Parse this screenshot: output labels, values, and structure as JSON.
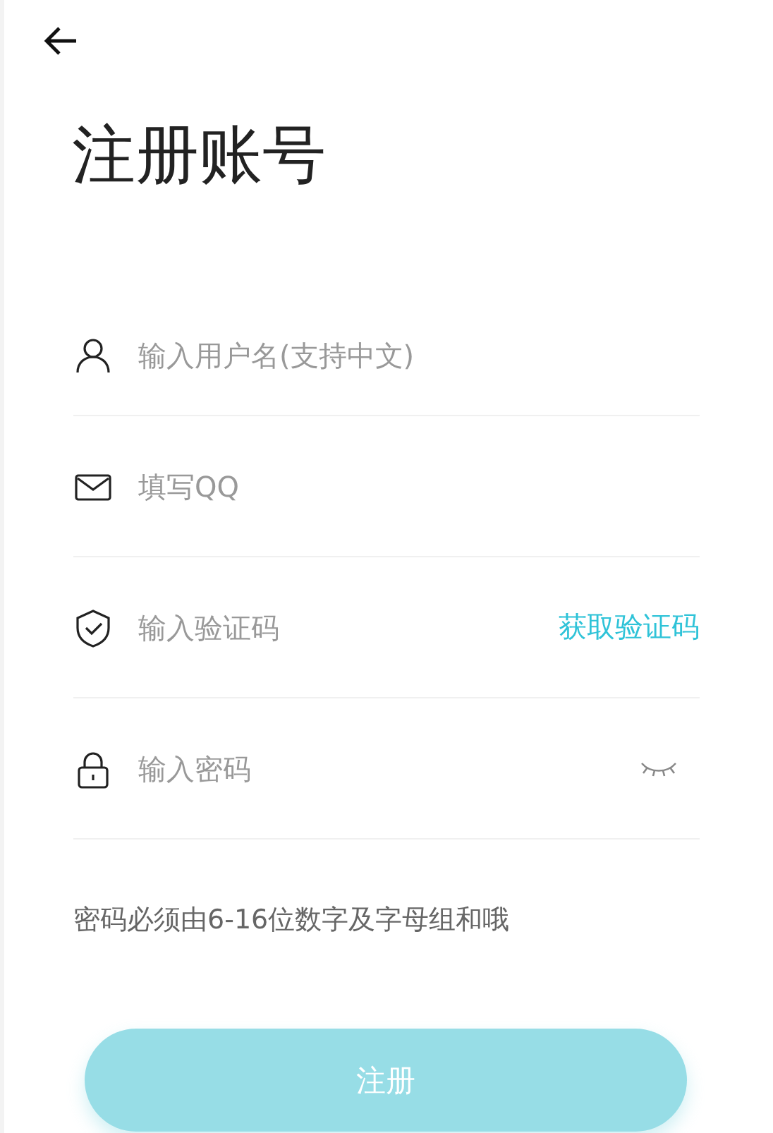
{
  "title": "注册账号",
  "fields": [
    {
      "kind": "user",
      "placeholder": "输入用户名(支持中文)"
    },
    {
      "kind": "mail",
      "placeholder": "填写QQ"
    },
    {
      "kind": "shield",
      "placeholder": "输入验证码",
      "action": "获取验证码"
    },
    {
      "kind": "lock",
      "placeholder": "输入密码",
      "password_visible": false
    }
  ],
  "hint": "密码必须由6-16位数字及字母组和哦",
  "submit": "注册"
}
